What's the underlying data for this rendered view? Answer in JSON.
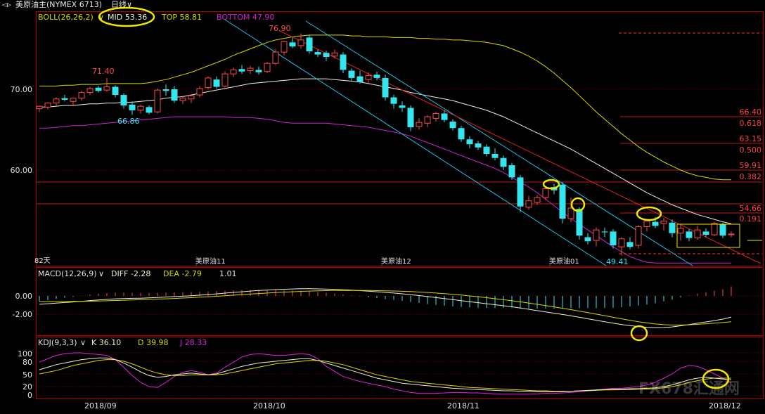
{
  "header": {
    "nav_glyph": "◅▹",
    "title": "美原油主(NYMEX 6713)",
    "period": "日线∨"
  },
  "colors": {
    "background": "#000000",
    "border": "#b40000",
    "bull": "#ff4a4a",
    "bear": "#33e6ee",
    "mid": "#f0f0e0",
    "top": "#d8d800",
    "bottom": "#d020d0",
    "channel": "#18c4e8",
    "trend": "#e02020",
    "highlight": "#f0e800",
    "diff": "#f0f0d0",
    "dea": "#d8d800",
    "k": "#f0f0d0",
    "d": "#d8d800",
    "j": "#e020e0"
  },
  "main_panel": {
    "legend": {
      "name": "BOLL(26,26,2)",
      "caret": "∨",
      "mid_label": "MID 53.36",
      "top_label": "TOP 58.81",
      "bottom_label": "BOTTOM 47.90"
    },
    "y_ticks": [
      "70.00",
      "60.00"
    ],
    "annotations": {
      "high1": "71.40",
      "low1": "66.86",
      "peak": "76.90",
      "low2": "49.41"
    },
    "footer": {
      "days": "82天",
      "contract_11": "美原油11",
      "contract_12": "美原油12",
      "contract_01": "美原油01"
    },
    "fib_levels": [
      {
        "label": "66.40",
        "value": 66.4
      },
      {
        "label": "0.618",
        "value": 64.7
      },
      {
        "label": "63.15",
        "value": 63.15
      },
      {
        "label": "0.500",
        "value": 61.6
      },
      {
        "label": "59.91",
        "value": 59.91
      },
      {
        "label": "0.382",
        "value": 58.5
      },
      {
        "label": "54.66",
        "value": 54.66
      },
      {
        "label": "0.191",
        "value": 53.4
      }
    ],
    "trend_line_price": 56.0
  },
  "macd_panel": {
    "name": "MACD(12,26,9)",
    "caret": "∨",
    "diff_label": "DIFF -2.28",
    "dea_label": "DEA -2.79",
    "macd_label": "1.01",
    "y_ticks": [
      "0.00",
      "-2.00"
    ]
  },
  "kdj_panel": {
    "name": "KDJ(9,3,3)",
    "caret": "∨",
    "k_label": "K 36.10",
    "d_label": "D 39.98",
    "j_label": "J 28.33",
    "y_ticks": [
      "100",
      "80",
      "50",
      "20",
      "0"
    ]
  },
  "x_axis": {
    "labels": [
      "2018/09",
      "2018/10",
      "2018/11",
      "2018/12"
    ]
  },
  "watermark": "FX678汇通网",
  "chart_data": {
    "type": "candlestick",
    "instrument": "美原油主(NYMEX 6713)",
    "period": "日线",
    "price_ylim": [
      48.5,
      79.0
    ],
    "candles": [
      {
        "o": 67.6,
        "h": 68.0,
        "l": 67.2,
        "c": 67.9
      },
      {
        "o": 67.8,
        "h": 68.4,
        "l": 67.5,
        "c": 68.3
      },
      {
        "o": 68.3,
        "h": 69.0,
        "l": 68.0,
        "c": 68.8
      },
      {
        "o": 68.9,
        "h": 69.3,
        "l": 68.5,
        "c": 68.7
      },
      {
        "o": 68.5,
        "h": 69.0,
        "l": 68.0,
        "c": 68.9
      },
      {
        "o": 68.9,
        "h": 69.8,
        "l": 68.6,
        "c": 69.6
      },
      {
        "o": 69.6,
        "h": 70.3,
        "l": 69.3,
        "c": 70.1
      },
      {
        "o": 70.2,
        "h": 70.4,
        "l": 69.6,
        "c": 69.8
      },
      {
        "o": 69.9,
        "h": 71.4,
        "l": 69.7,
        "c": 70.3
      },
      {
        "o": 70.3,
        "h": 70.5,
        "l": 69.0,
        "c": 69.3
      },
      {
        "o": 69.3,
        "h": 69.5,
        "l": 67.6,
        "c": 68.0
      },
      {
        "o": 68.1,
        "h": 68.5,
        "l": 66.86,
        "c": 67.4
      },
      {
        "o": 67.4,
        "h": 68.1,
        "l": 67.0,
        "c": 67.9
      },
      {
        "o": 67.8,
        "h": 68.0,
        "l": 66.9,
        "c": 67.1
      },
      {
        "o": 67.2,
        "h": 70.1,
        "l": 67.0,
        "c": 69.9
      },
      {
        "o": 70.0,
        "h": 70.6,
        "l": 69.2,
        "c": 69.8
      },
      {
        "o": 70.0,
        "h": 70.4,
        "l": 68.3,
        "c": 68.6
      },
      {
        "o": 68.6,
        "h": 69.2,
        "l": 68.2,
        "c": 68.9
      },
      {
        "o": 68.8,
        "h": 69.4,
        "l": 68.3,
        "c": 69.2
      },
      {
        "o": 69.3,
        "h": 70.4,
        "l": 69.0,
        "c": 70.1
      },
      {
        "o": 70.2,
        "h": 71.6,
        "l": 70.0,
        "c": 71.4
      },
      {
        "o": 71.2,
        "h": 71.6,
        "l": 70.1,
        "c": 70.3
      },
      {
        "o": 70.4,
        "h": 72.2,
        "l": 70.2,
        "c": 71.9
      },
      {
        "o": 71.9,
        "h": 72.7,
        "l": 71.5,
        "c": 72.4
      },
      {
        "o": 72.5,
        "h": 73.0,
        "l": 71.9,
        "c": 72.2
      },
      {
        "o": 72.3,
        "h": 72.9,
        "l": 71.9,
        "c": 72.6
      },
      {
        "o": 72.4,
        "h": 72.8,
        "l": 71.8,
        "c": 72.1
      },
      {
        "o": 72.2,
        "h": 73.4,
        "l": 72.0,
        "c": 73.2
      },
      {
        "o": 73.2,
        "h": 75.0,
        "l": 73.0,
        "c": 74.6
      },
      {
        "o": 74.6,
        "h": 76.0,
        "l": 74.2,
        "c": 75.9
      },
      {
        "o": 75.8,
        "h": 76.4,
        "l": 75.1,
        "c": 75.3
      },
      {
        "o": 75.4,
        "h": 76.9,
        "l": 75.0,
        "c": 76.1
      },
      {
        "o": 76.4,
        "h": 76.7,
        "l": 74.4,
        "c": 74.7
      },
      {
        "o": 74.6,
        "h": 74.9,
        "l": 74.0,
        "c": 74.3
      },
      {
        "o": 74.5,
        "h": 74.8,
        "l": 73.5,
        "c": 74.0
      },
      {
        "o": 74.1,
        "h": 74.9,
        "l": 73.8,
        "c": 74.5
      },
      {
        "o": 74.3,
        "h": 74.6,
        "l": 72.0,
        "c": 72.4
      },
      {
        "o": 72.3,
        "h": 72.6,
        "l": 71.0,
        "c": 71.4
      },
      {
        "o": 71.6,
        "h": 72.3,
        "l": 70.7,
        "c": 70.9
      },
      {
        "o": 71.2,
        "h": 72.1,
        "l": 70.8,
        "c": 71.7
      },
      {
        "o": 71.8,
        "h": 72.2,
        "l": 71.1,
        "c": 71.4
      },
      {
        "o": 71.4,
        "h": 71.8,
        "l": 68.6,
        "c": 69.0
      },
      {
        "o": 69.0,
        "h": 69.3,
        "l": 67.6,
        "c": 68.2
      },
      {
        "o": 68.0,
        "h": 68.5,
        "l": 67.2,
        "c": 67.7
      },
      {
        "o": 67.7,
        "h": 68.0,
        "l": 64.8,
        "c": 65.3
      },
      {
        "o": 65.4,
        "h": 66.4,
        "l": 65.0,
        "c": 65.9
      },
      {
        "o": 65.8,
        "h": 66.8,
        "l": 65.3,
        "c": 66.6
      },
      {
        "o": 66.4,
        "h": 67.2,
        "l": 66.0,
        "c": 67.0
      },
      {
        "o": 67.0,
        "h": 67.4,
        "l": 65.9,
        "c": 66.2
      },
      {
        "o": 66.0,
        "h": 66.3,
        "l": 64.9,
        "c": 65.2
      },
      {
        "o": 65.2,
        "h": 65.5,
        "l": 63.5,
        "c": 63.8
      },
      {
        "o": 63.8,
        "h": 64.2,
        "l": 62.7,
        "c": 63.2
      },
      {
        "o": 63.3,
        "h": 63.6,
        "l": 62.5,
        "c": 62.8
      },
      {
        "o": 62.9,
        "h": 63.2,
        "l": 61.7,
        "c": 62.0
      },
      {
        "o": 62.0,
        "h": 62.7,
        "l": 61.2,
        "c": 61.5
      },
      {
        "o": 61.5,
        "h": 61.8,
        "l": 60.0,
        "c": 60.4
      },
      {
        "o": 60.6,
        "h": 60.9,
        "l": 58.8,
        "c": 59.1
      },
      {
        "o": 59.1,
        "h": 59.4,
        "l": 54.8,
        "c": 55.5
      },
      {
        "o": 55.4,
        "h": 56.8,
        "l": 55.1,
        "c": 56.2
      },
      {
        "o": 56.0,
        "h": 56.9,
        "l": 55.7,
        "c": 56.6
      },
      {
        "o": 56.6,
        "h": 57.9,
        "l": 56.3,
        "c": 57.7
      },
      {
        "o": 57.9,
        "h": 58.3,
        "l": 57.0,
        "c": 57.5
      },
      {
        "o": 58.2,
        "h": 58.5,
        "l": 53.4,
        "c": 54.0
      },
      {
        "o": 54.0,
        "h": 56.6,
        "l": 53.6,
        "c": 55.3
      },
      {
        "o": 55.2,
        "h": 55.4,
        "l": 51.4,
        "c": 51.9
      },
      {
        "o": 51.7,
        "h": 52.2,
        "l": 50.8,
        "c": 51.2
      },
      {
        "o": 51.3,
        "h": 52.9,
        "l": 50.6,
        "c": 52.6
      },
      {
        "o": 52.4,
        "h": 52.9,
        "l": 51.7,
        "c": 52.3
      },
      {
        "o": 52.4,
        "h": 52.7,
        "l": 50.3,
        "c": 50.7
      },
      {
        "o": 50.5,
        "h": 51.7,
        "l": 49.41,
        "c": 51.5
      },
      {
        "o": 51.1,
        "h": 51.7,
        "l": 50.2,
        "c": 50.5
      },
      {
        "o": 50.7,
        "h": 53.2,
        "l": 50.3,
        "c": 53.0
      },
      {
        "o": 53.0,
        "h": 53.9,
        "l": 52.4,
        "c": 53.7
      },
      {
        "o": 53.6,
        "h": 54.2,
        "l": 52.8,
        "c": 53.1
      },
      {
        "o": 53.4,
        "h": 54.1,
        "l": 52.5,
        "c": 53.7
      },
      {
        "o": 53.5,
        "h": 53.9,
        "l": 51.7,
        "c": 52.2
      },
      {
        "o": 52.2,
        "h": 53.2,
        "l": 51.3,
        "c": 52.8
      },
      {
        "o": 52.4,
        "h": 52.7,
        "l": 51.2,
        "c": 51.6
      },
      {
        "o": 51.6,
        "h": 53.1,
        "l": 51.4,
        "c": 52.6
      },
      {
        "o": 52.4,
        "h": 52.8,
        "l": 51.7,
        "c": 52.0
      },
      {
        "o": 52.0,
        "h": 53.6,
        "l": 51.8,
        "c": 53.4
      },
      {
        "o": 53.3,
        "h": 53.5,
        "l": 51.6,
        "c": 51.9
      },
      {
        "o": 52.0,
        "h": 52.4,
        "l": 51.7,
        "c": 52.1
      }
    ],
    "boll_mid": [
      67.8,
      67.8,
      67.9,
      68.0,
      68.0,
      68.1,
      68.2,
      68.2,
      68.3,
      68.3,
      68.4,
      68.4,
      68.5,
      68.6,
      68.7,
      68.9,
      69.0,
      69.1,
      69.3,
      69.5,
      69.7,
      69.9,
      70.1,
      70.3,
      70.5,
      70.7,
      70.8,
      70.9,
      71.0,
      71.1,
      71.2,
      71.3,
      71.3,
      71.3,
      71.3,
      71.2,
      71.1,
      71.0,
      70.9,
      70.7,
      70.5,
      70.3,
      70.1,
      69.9,
      69.6,
      69.4,
      69.2,
      69.0,
      68.8,
      68.6,
      68.3,
      68.0,
      67.7,
      67.4,
      67.0,
      66.6,
      66.1,
      65.6,
      65.1,
      64.6,
      64.1,
      63.6,
      63.1,
      62.6,
      62.0,
      61.4,
      60.8,
      60.2,
      59.6,
      59.0,
      58.4,
      57.8,
      57.2,
      56.7,
      56.2,
      55.7,
      55.3,
      54.9,
      54.5,
      54.2,
      53.9,
      53.6,
      53.36
    ],
    "boll_top": [
      70.4,
      70.4,
      70.4,
      70.5,
      70.5,
      70.6,
      70.6,
      70.6,
      70.7,
      70.7,
      70.7,
      70.7,
      70.7,
      70.8,
      71.0,
      71.2,
      71.5,
      71.8,
      72.1,
      72.5,
      72.9,
      73.3,
      73.7,
      74.2,
      74.6,
      75.0,
      75.4,
      75.8,
      76.1,
      76.3,
      76.5,
      76.6,
      76.7,
      76.7,
      76.7,
      76.7,
      76.7,
      76.6,
      76.6,
      76.5,
      76.5,
      76.5,
      76.4,
      76.4,
      76.4,
      76.3,
      76.3,
      76.2,
      76.2,
      76.1,
      76.1,
      76.0,
      75.9,
      75.8,
      75.6,
      75.4,
      75.0,
      74.6,
      74.1,
      73.5,
      72.8,
      72.0,
      71.1,
      70.2,
      69.2,
      68.2,
      67.2,
      66.3,
      65.4,
      64.5,
      63.7,
      62.9,
      62.2,
      61.6,
      61.0,
      60.5,
      60.0,
      59.6,
      59.3,
      59.1,
      58.9,
      58.8,
      58.81
    ],
    "boll_bottom": [
      65.2,
      65.2,
      65.3,
      65.4,
      65.5,
      65.5,
      65.6,
      65.7,
      65.8,
      65.9,
      66.0,
      66.1,
      66.2,
      66.3,
      66.4,
      66.5,
      66.6,
      66.6,
      66.6,
      66.6,
      66.6,
      66.6,
      66.6,
      66.5,
      66.5,
      66.5,
      66.4,
      66.3,
      66.1,
      65.9,
      65.8,
      65.8,
      65.8,
      65.8,
      65.8,
      65.7,
      65.6,
      65.5,
      65.4,
      65.3,
      65.1,
      64.9,
      64.7,
      64.5,
      64.2,
      63.8,
      63.4,
      63.0,
      62.6,
      62.2,
      61.8,
      61.4,
      61.0,
      60.6,
      60.2,
      59.7,
      59.1,
      58.5,
      57.9,
      57.2,
      56.4,
      55.6,
      54.8,
      54.0,
      53.3,
      52.6,
      51.9,
      51.2,
      50.5,
      49.9,
      49.3,
      48.9,
      48.6,
      48.5,
      48.5,
      48.5,
      48.5,
      48.5,
      48.5,
      48.5,
      48.5,
      48.5,
      48.5
    ],
    "macd": {
      "ylim": [
        -3.9,
        1.3
      ],
      "diff": [
        -0.9,
        -0.84,
        -0.77,
        -0.71,
        -0.65,
        -0.58,
        -0.5,
        -0.43,
        -0.37,
        -0.31,
        -0.28,
        -0.26,
        -0.24,
        -0.21,
        -0.17,
        -0.12,
        -0.07,
        -0.03,
        0.02,
        0.08,
        0.15,
        0.22,
        0.3,
        0.38,
        0.45,
        0.52,
        0.58,
        0.63,
        0.68,
        0.72,
        0.75,
        0.77,
        0.77,
        0.76,
        0.74,
        0.71,
        0.67,
        0.62,
        0.57,
        0.51,
        0.45,
        0.38,
        0.31,
        0.23,
        0.14,
        0.04,
        -0.07,
        -0.18,
        -0.29,
        -0.4,
        -0.51,
        -0.62,
        -0.73,
        -0.84,
        -0.95,
        -1.06,
        -1.17,
        -1.3,
        -1.44,
        -1.58,
        -1.72,
        -1.86,
        -2.0,
        -2.14,
        -2.3,
        -2.46,
        -2.62,
        -2.78,
        -2.94,
        -3.08,
        -3.2,
        -3.3,
        -3.38,
        -3.42,
        -3.4,
        -3.34,
        -3.22,
        -3.08,
        -2.94,
        -2.8,
        -2.66,
        -2.5,
        -2.28
      ],
      "dea": [
        -0.6,
        -0.61,
        -0.61,
        -0.61,
        -0.6,
        -0.59,
        -0.57,
        -0.55,
        -0.52,
        -0.49,
        -0.46,
        -0.43,
        -0.4,
        -0.37,
        -0.34,
        -0.31,
        -0.27,
        -0.23,
        -0.19,
        -0.14,
        -0.09,
        -0.04,
        0.02,
        0.08,
        0.14,
        0.2,
        0.26,
        0.31,
        0.36,
        0.41,
        0.45,
        0.49,
        0.52,
        0.55,
        0.57,
        0.58,
        0.59,
        0.59,
        0.59,
        0.58,
        0.57,
        0.55,
        0.53,
        0.5,
        0.47,
        0.42,
        0.37,
        0.31,
        0.24,
        0.17,
        0.09,
        0.0,
        -0.09,
        -0.19,
        -0.3,
        -0.41,
        -0.52,
        -0.64,
        -0.77,
        -0.9,
        -1.04,
        -1.18,
        -1.33,
        -1.48,
        -1.64,
        -1.8,
        -1.96,
        -2.13,
        -2.3,
        -2.47,
        -2.63,
        -2.78,
        -2.91,
        -3.02,
        -3.1,
        -3.14,
        -3.14,
        -3.11,
        -3.06,
        -3.0,
        -2.94,
        -2.87,
        -2.79
      ]
    },
    "kdj": {
      "ylim": [
        0,
        100
      ],
      "k": [
        60,
        66,
        72,
        76,
        80,
        84,
        86,
        88,
        88,
        84,
        76,
        66,
        55,
        46,
        42,
        44,
        48,
        50,
        52,
        50,
        48,
        50,
        56,
        62,
        68,
        72,
        76,
        78,
        80,
        82,
        84,
        86,
        86,
        82,
        76,
        70,
        64,
        58,
        52,
        46,
        40,
        36,
        32,
        28,
        26,
        24,
        22,
        20,
        18,
        16,
        15,
        14,
        13,
        12,
        11,
        10,
        10,
        9,
        9,
        8,
        8,
        8,
        8,
        9,
        10,
        11,
        12,
        13,
        14,
        14,
        15,
        15,
        16,
        17,
        20,
        24,
        30,
        36,
        40,
        42,
        40,
        38,
        36.1
      ],
      "d": [
        50,
        54,
        58,
        64,
        70,
        74,
        78,
        82,
        84,
        84,
        80,
        74,
        66,
        58,
        52,
        48,
        46,
        46,
        48,
        48,
        48,
        48,
        50,
        54,
        58,
        62,
        66,
        70,
        74,
        76,
        78,
        80,
        82,
        82,
        80,
        76,
        72,
        66,
        60,
        54,
        48,
        44,
        40,
        36,
        32,
        30,
        28,
        26,
        24,
        22,
        20,
        18,
        17,
        16,
        15,
        14,
        13,
        12,
        11,
        10,
        10,
        9,
        9,
        9,
        10,
        10,
        11,
        12,
        12,
        13,
        13,
        14,
        14,
        15,
        17,
        20,
        24,
        30,
        34,
        38,
        40,
        40,
        39.98
      ],
      "j": [
        78,
        86,
        94,
        98,
        100,
        100,
        98,
        96,
        94,
        84,
        66,
        46,
        30,
        20,
        18,
        30,
        44,
        54,
        58,
        54,
        48,
        52,
        66,
        78,
        90,
        96,
        98,
        96,
        94,
        94,
        96,
        98,
        96,
        86,
        68,
        56,
        44,
        38,
        32,
        28,
        24,
        20,
        14,
        10,
        6,
        4,
        4,
        4,
        5,
        6,
        6,
        5,
        5,
        4,
        3,
        2,
        2,
        2,
        2,
        3,
        4,
        4,
        5,
        6,
        8,
        10,
        12,
        14,
        16,
        16,
        18,
        20,
        24,
        30,
        40,
        50,
        64,
        70,
        68,
        60,
        50,
        40,
        28.33
      ]
    }
  }
}
